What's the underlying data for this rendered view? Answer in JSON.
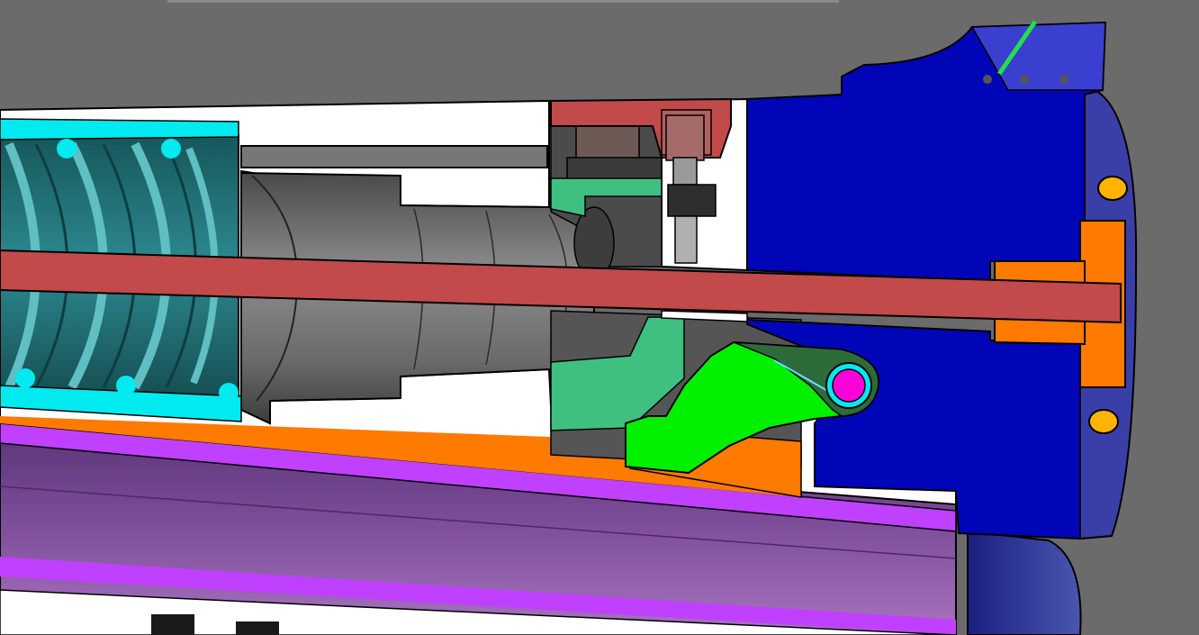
{
  "scene": {
    "kind": "3d-cad-section-view",
    "background_color": "#6b6b6b",
    "parts": [
      {
        "name": "housing-block",
        "color": "#0005b8"
      },
      {
        "name": "seal-ring",
        "color": "#00eaf0"
      },
      {
        "name": "bellows",
        "color": "#1e6f73"
      },
      {
        "name": "shaft",
        "color": "#b94343"
      },
      {
        "name": "bushing",
        "color": "#ff7a00"
      },
      {
        "name": "lever",
        "color": "#00f000"
      },
      {
        "name": "pivot-pin",
        "color": "#ff00d8"
      },
      {
        "name": "guide-block",
        "color": "#3fbf80"
      },
      {
        "name": "outer-tube",
        "color": "#8f58a8"
      },
      {
        "name": "tube-stripe",
        "color": "#c040ff"
      },
      {
        "name": "cap-screw",
        "color": "#ffb400"
      }
    ]
  }
}
